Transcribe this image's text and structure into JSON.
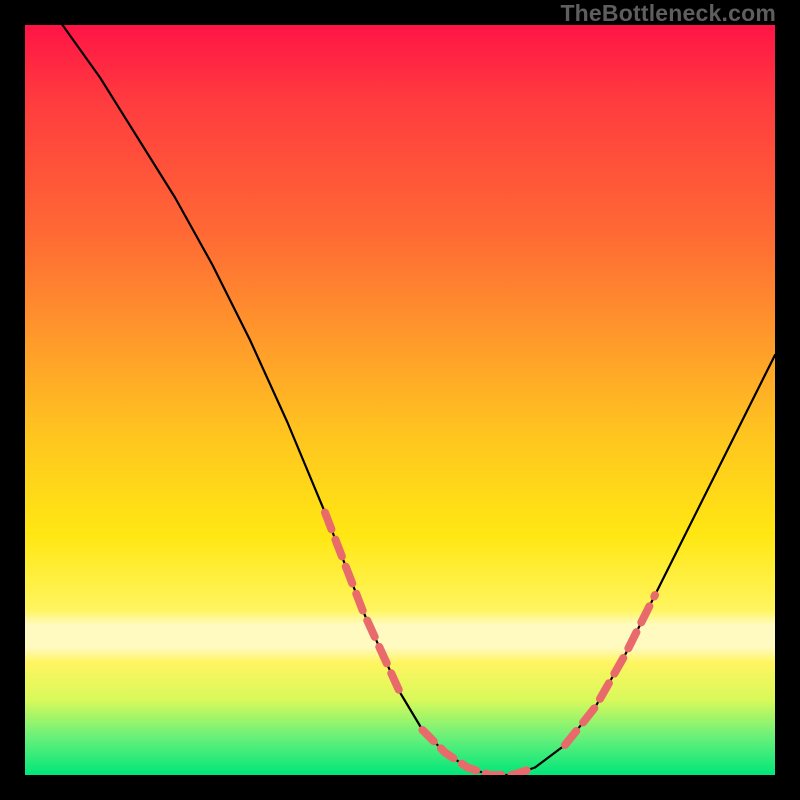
{
  "watermark": "TheBottleneck.com",
  "chart_data": {
    "type": "line",
    "title": "",
    "xlabel": "",
    "ylabel": "",
    "xlim": [
      0,
      100
    ],
    "ylim": [
      0,
      100
    ],
    "series": [
      {
        "name": "curve",
        "x": [
          5,
          10,
          15,
          20,
          25,
          30,
          35,
          40,
          45,
          50,
          53,
          56,
          59,
          62,
          65,
          68,
          72,
          76,
          80,
          84,
          88,
          92,
          96,
          100
        ],
        "values": [
          100,
          93,
          85,
          77,
          68,
          58,
          47,
          35,
          22,
          11,
          6,
          3,
          1,
          0,
          0,
          1,
          4,
          9,
          16,
          24,
          32,
          40,
          48,
          56
        ]
      }
    ],
    "highlight_segments": [
      {
        "side": "left",
        "x": [
          40,
          50
        ],
        "y": [
          35,
          11
        ]
      },
      {
        "side": "right",
        "x": [
          72,
          84
        ],
        "y": [
          4,
          24
        ]
      }
    ],
    "flat_bottom": {
      "x": [
        53,
        68
      ],
      "y": [
        0,
        1
      ]
    }
  }
}
